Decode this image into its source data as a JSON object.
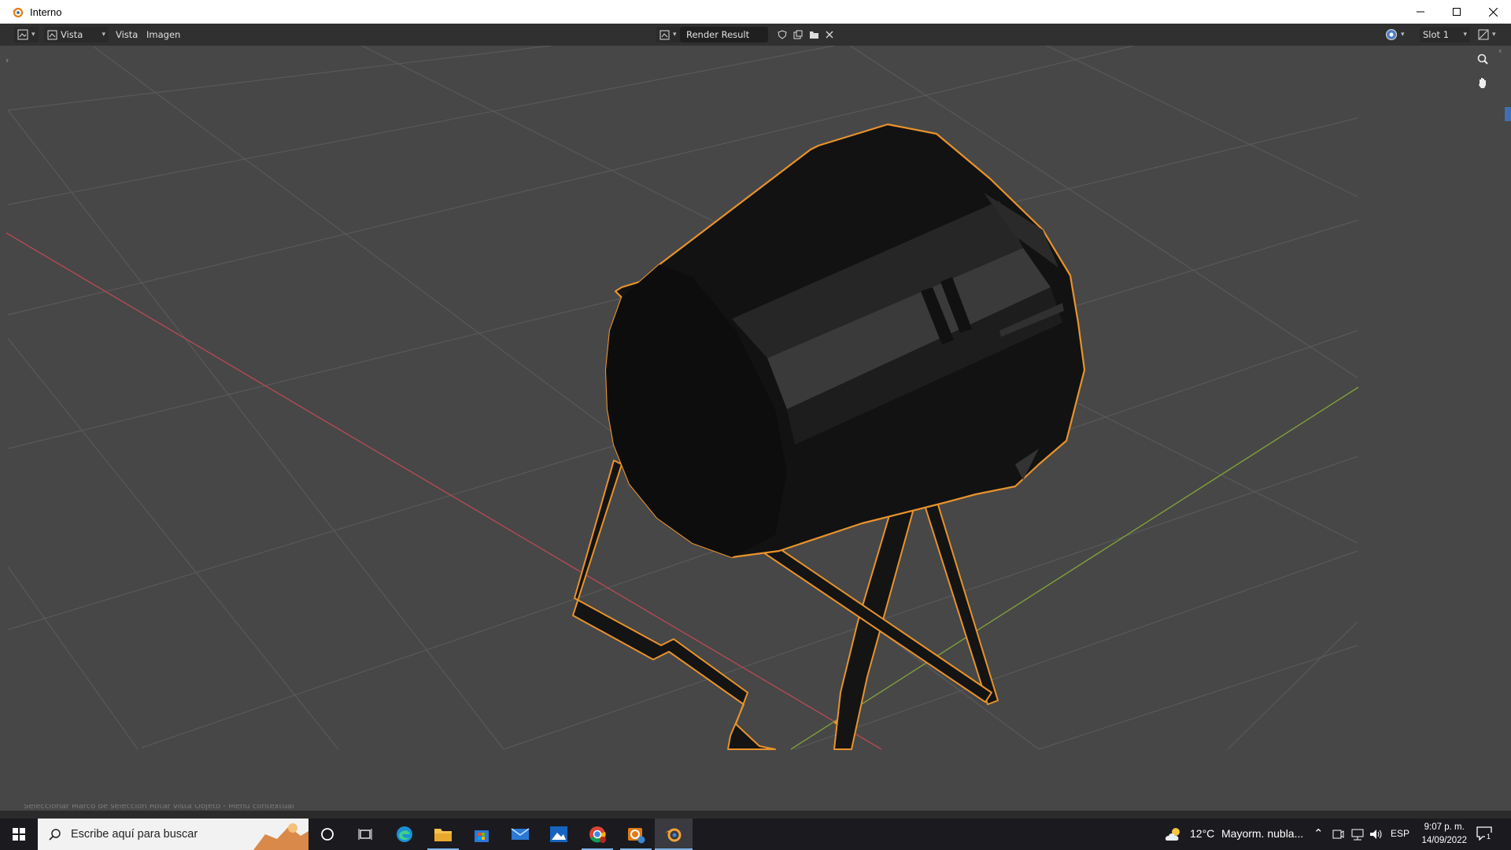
{
  "window": {
    "title": "Interno",
    "controls": [
      "minimize",
      "maximize",
      "close"
    ]
  },
  "editor_header": {
    "view_menu_dropdown": "Vista",
    "menus": [
      "Vista",
      "Imagen"
    ],
    "image_name": "Render Result",
    "slot": "Slot 1"
  },
  "viewport": {
    "grid_color": "#5a5a5a",
    "background": "#474747",
    "x_axis_color": "#b24a55",
    "y_axis_color": "#7fa03a",
    "selection_outline": "#e8932c",
    "object": "3D spotlight model on stand, selected"
  },
  "status_hint": "Seleccionar    Marco de selección    Rotar vista    Objeto - Menú contextual",
  "taskbar": {
    "search_placeholder": "Escribe aquí para buscar",
    "weather_temp": "12°C",
    "weather_text": "Mayorm. nubla...",
    "language": "ESP",
    "time": "9:07 p. m.",
    "date": "14/09/2022",
    "notification_count": "1",
    "colors": {
      "bar": "#1b1b1f",
      "search": "#f2f2f2"
    }
  }
}
